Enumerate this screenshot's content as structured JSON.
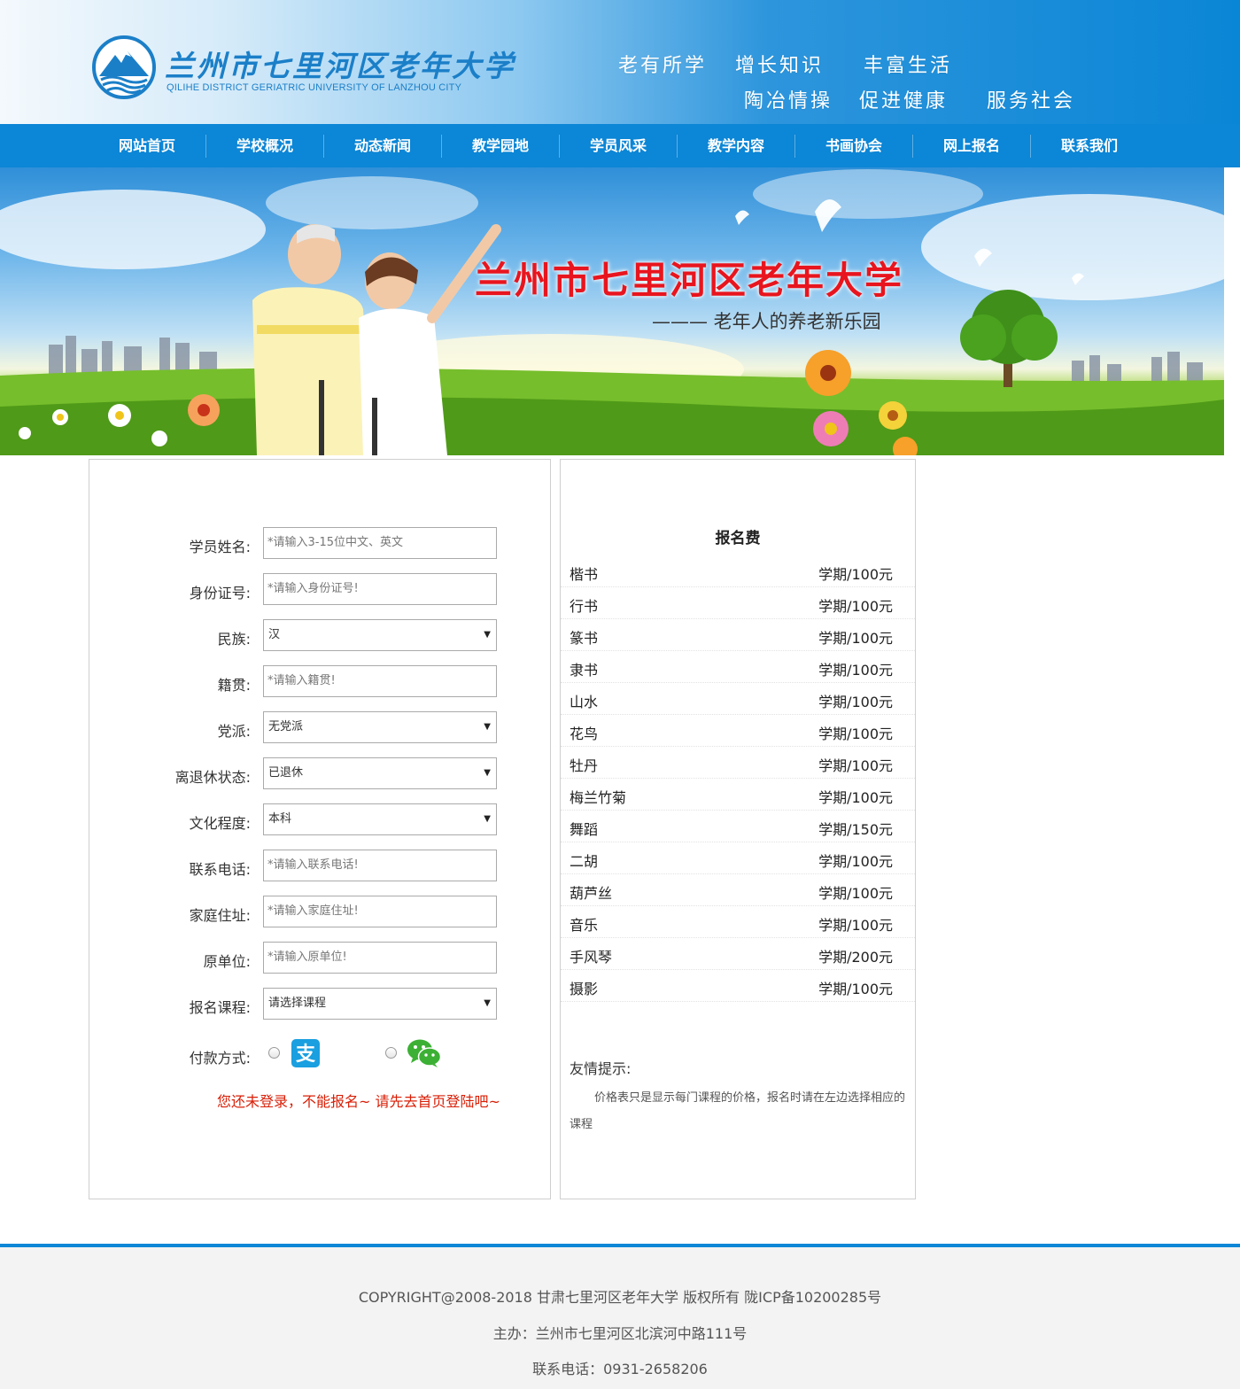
{
  "header": {
    "logo_cn": "兰州市七里河区老年大学",
    "logo_en": "QILIHE DISTRICT GERIATRIC UNIVERSITY OF LANZHOU CITY",
    "slogans": [
      "老有所学",
      "增长知识",
      "丰富生活",
      "陶冶情操",
      "促进健康",
      "服务社会"
    ]
  },
  "nav": {
    "items": [
      "网站首页",
      "学校概况",
      "动态新闻",
      "教学园地",
      "学员风采",
      "教学内容",
      "书画协会",
      "网上报名",
      "联系我们"
    ]
  },
  "banner": {
    "title": "兰州市七里河区老年大学",
    "subtitle": "——— 老年人的养老新乐园"
  },
  "form": {
    "fields": [
      {
        "label": "学员姓名:",
        "type": "input",
        "placeholder": "*请输入3-15位中文、英文"
      },
      {
        "label": "身份证号:",
        "type": "input",
        "placeholder": "*请输入身份证号!"
      },
      {
        "label": "民族:",
        "type": "select",
        "value": "汉"
      },
      {
        "label": "籍贯:",
        "type": "input",
        "placeholder": "*请输入籍贯!"
      },
      {
        "label": "党派:",
        "type": "select",
        "value": "无党派"
      },
      {
        "label": "离退休状态:",
        "type": "select",
        "value": "已退休"
      },
      {
        "label": "文化程度:",
        "type": "select",
        "value": "本科"
      },
      {
        "label": "联系电话:",
        "type": "input",
        "placeholder": "*请输入联系电话!"
      },
      {
        "label": "家庭住址:",
        "type": "input",
        "placeholder": "*请输入家庭住址!"
      },
      {
        "label": "原单位:",
        "type": "input",
        "placeholder": "*请输入原单位!"
      },
      {
        "label": "报名课程:",
        "type": "select",
        "value": "请选择课程"
      }
    ],
    "payment_label": "付款方式:",
    "payment_options": [
      "alipay-icon",
      "wechat-pay-icon"
    ],
    "warning": "您还未登录，不能报名~ 请先去首页登陆吧~",
    "colors": {
      "warning": "#d81e06",
      "alipay": "#1a9fe0",
      "wechat": "#3cb034"
    }
  },
  "fees": {
    "title": "报名费",
    "rows": [
      {
        "name": "楷书",
        "price": "学期/100元"
      },
      {
        "name": "行书",
        "price": "学期/100元"
      },
      {
        "name": "篆书",
        "price": "学期/100元"
      },
      {
        "name": "隶书",
        "price": "学期/100元"
      },
      {
        "name": "山水",
        "price": "学期/100元"
      },
      {
        "name": "花鸟",
        "price": "学期/100元"
      },
      {
        "name": "牡丹",
        "price": "学期/100元"
      },
      {
        "name": "梅兰竹菊",
        "price": "学期/100元"
      },
      {
        "name": "舞蹈",
        "price": "学期/150元"
      },
      {
        "name": "二胡",
        "price": "学期/100元"
      },
      {
        "name": "葫芦丝",
        "price": "学期/100元"
      },
      {
        "name": "音乐",
        "price": "学期/100元"
      },
      {
        "name": "手风琴",
        "price": "学期/200元"
      },
      {
        "name": "摄影",
        "price": "学期/100元"
      }
    ],
    "tip_title": "友情提示:",
    "tip_text": "价格表只是显示每门课程的价格，报名时请在左边选择相应的课程"
  },
  "footer": {
    "copyright": "COPYRIGHT@2008-2018 甘肃七里河区老年大学 版权所有 陇ICP备10200285号",
    "address": "主办：兰州市七里河区北滨河中路111号",
    "phone": "联系电话：0931-2658206"
  },
  "theme": {
    "primary": "#0c86d6"
  }
}
